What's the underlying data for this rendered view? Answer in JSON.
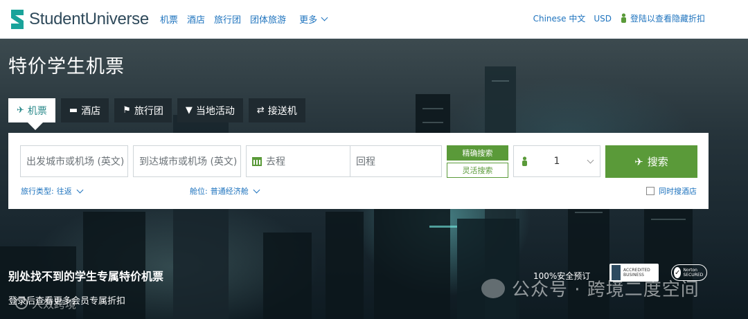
{
  "brand": {
    "name": "StudentUniverse",
    "color": "#2f4a5b",
    "accent": "#2b8a8b"
  },
  "nav": {
    "items": [
      "机票",
      "酒店",
      "旅行团",
      "团体旅游"
    ],
    "more": "更多"
  },
  "topright": {
    "language": "Chinese 中文",
    "currency": "USD",
    "login": "登陆以查看隐藏折扣"
  },
  "hero": {
    "title": "特价学生机票"
  },
  "tabs": [
    {
      "label": "机票",
      "icon": "plane-icon",
      "active": true
    },
    {
      "label": "酒店",
      "icon": "bed-icon",
      "active": false
    },
    {
      "label": "旅行团",
      "icon": "flag-icon",
      "active": false
    },
    {
      "label": "当地活动",
      "icon": "ticket-icon",
      "active": false
    },
    {
      "label": "接送机",
      "icon": "transfer-icon",
      "active": false
    }
  ],
  "search": {
    "origin_placeholder": "出发城市或机场 (英文)",
    "destination_placeholder": "到达城市或机场 (英文)",
    "depart_placeholder": "去程",
    "return_placeholder": "回程",
    "precise_label": "精确搜索",
    "flexible_label": "灵活搜索",
    "passengers": "1",
    "search_label": "搜索",
    "trip_type_label": "旅行类型:",
    "trip_type_value": "往返",
    "cabin_label": "舱位:",
    "cabin_value": "普通经济舱",
    "hotel_checkbox_label": "同时搜酒店",
    "hotel_checked": false,
    "button_color": "#5a9a39"
  },
  "promo": {
    "headline": "别处找不到的学生专属特价机票",
    "subline": "登录后查看更多会员专属折扣",
    "secure_text": "100%安全预订",
    "bbb_text": "ACCREDITED BUSINESS",
    "norton_text": "Norton SECURED"
  },
  "watermarks": {
    "wechat": "公众号 · 跨境二度空间",
    "corner": "人效跨境"
  }
}
